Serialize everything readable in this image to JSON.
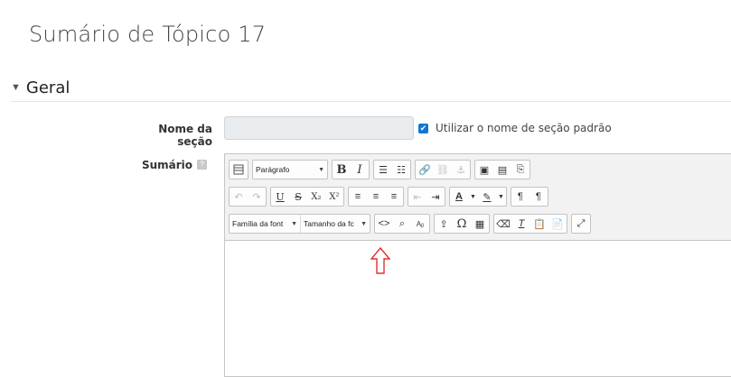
{
  "page": {
    "title": "Sumário de Tópico 17"
  },
  "section": {
    "label": "Geral"
  },
  "fields": {
    "name_label": "Nome da seção",
    "name_value": "",
    "default_name_checkbox_label": "Utilizar o nome de seção padrão",
    "default_name_checked": true,
    "summary_label": "Sumário"
  },
  "editor": {
    "paragraph_format": "Parágrafo",
    "font_family": "Família da font",
    "font_size": "Tamanho da fc",
    "content": ""
  },
  "icons": {
    "toggle_toolbar": "kitchen-sink-icon",
    "bold": "B",
    "italic": "I",
    "underline": "U",
    "strikethrough": "S",
    "subscript": "X₂",
    "superscript": "X²",
    "special_char": "Ω",
    "annotation_arrow": "up-arrow-outline"
  },
  "colors": {
    "accent": "#1177d1",
    "arrow": "#e03030"
  }
}
